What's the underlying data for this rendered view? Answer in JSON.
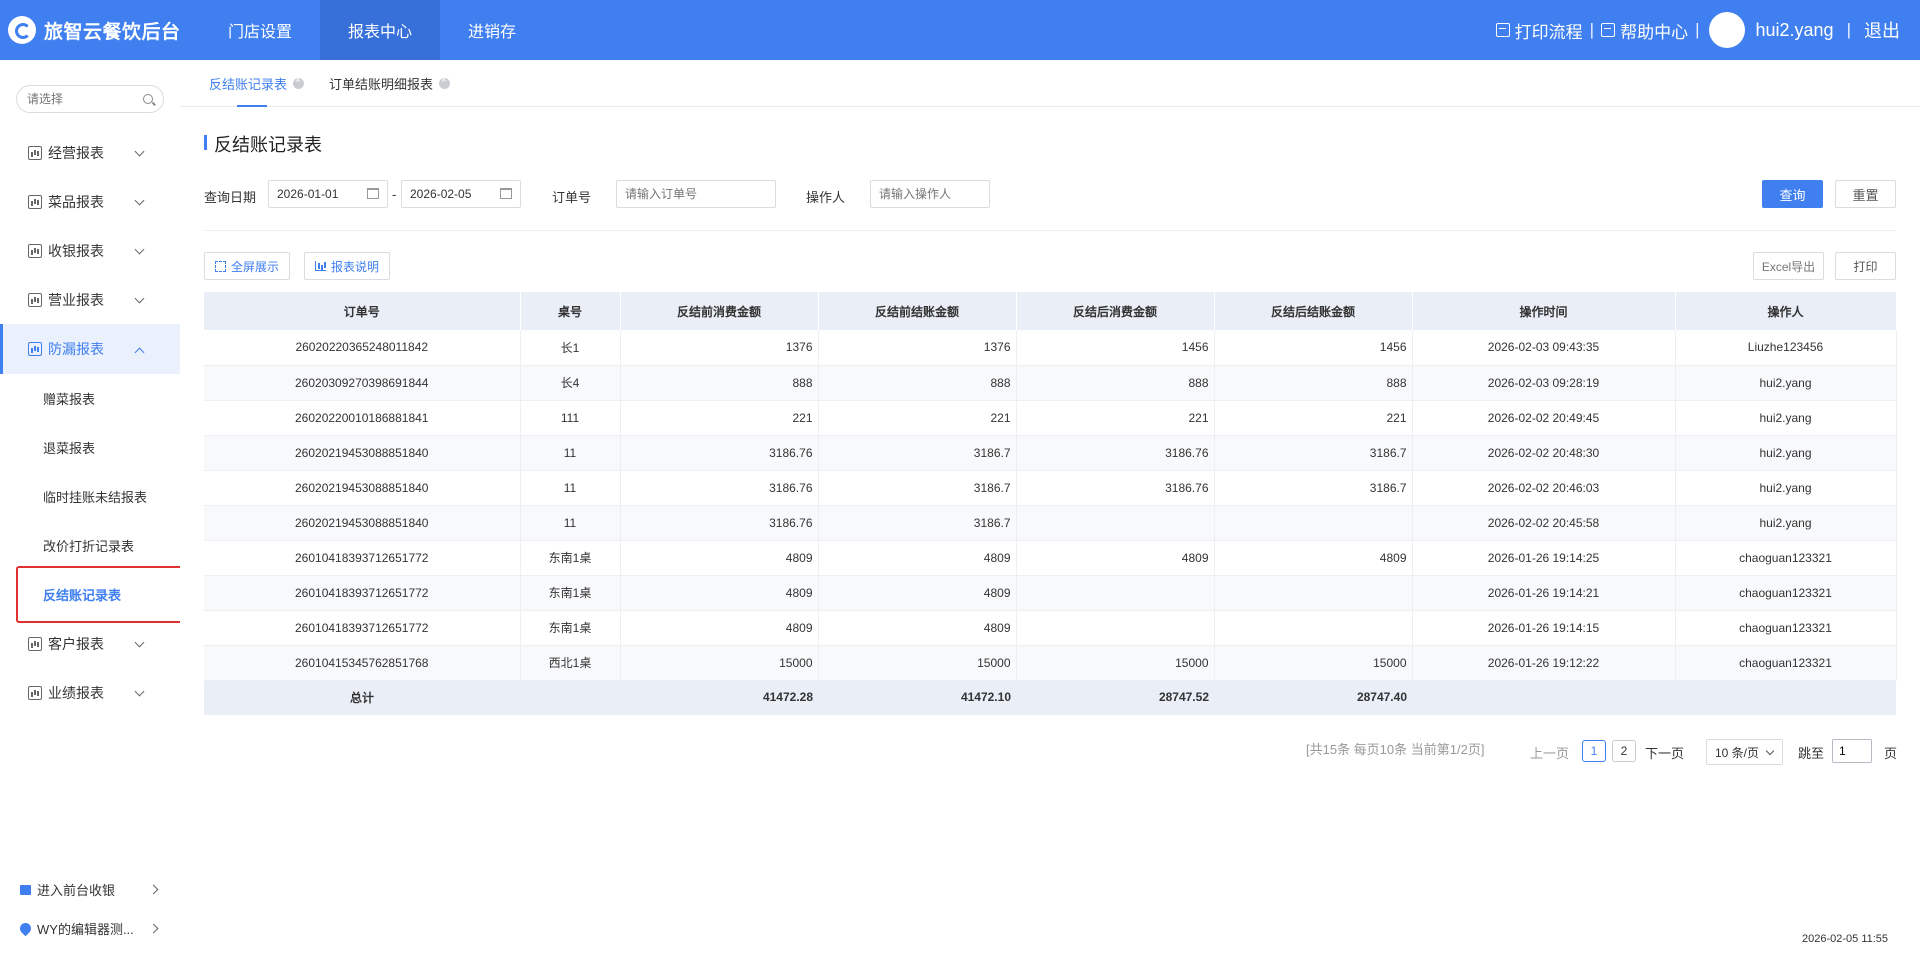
{
  "app": {
    "title": "旅智云餐饮后台"
  },
  "nav": {
    "items": [
      "门店设置",
      "报表中心",
      "进销存"
    ],
    "active_index": 1
  },
  "top_right": {
    "print_flow": "打印流程",
    "help_center": "帮助中心",
    "separator": "|",
    "username": "hui2.yang",
    "logout": "退出"
  },
  "sidebar": {
    "search_placeholder": "请选择",
    "menu": [
      {
        "label": "经营报表",
        "icon": "chart-icon"
      },
      {
        "label": "菜品报表",
        "icon": "dish-icon"
      },
      {
        "label": "收银报表",
        "icon": "cashier-icon"
      },
      {
        "label": "营业报表",
        "icon": "business-icon"
      },
      {
        "label": "防漏报表",
        "icon": "shield-icon"
      }
    ],
    "submenu": [
      "赠菜报表",
      "退菜报表",
      "临时挂账未结报表",
      "改价打折记录表",
      "反结账记录表"
    ],
    "menu_after": [
      {
        "label": "客户报表",
        "icon": "customer-icon"
      },
      {
        "label": "业绩报表",
        "icon": "performance-icon"
      }
    ],
    "bottom": {
      "front_cashier": "进入前台收银",
      "store": "WY的编辑器测..."
    }
  },
  "tabs": [
    {
      "label": "反结账记录表",
      "active": true
    },
    {
      "label": "订单结账明细报表",
      "active": false
    }
  ],
  "page": {
    "title": "反结账记录表"
  },
  "filters": {
    "date_label": "查询日期",
    "date_start": "2026-01-01",
    "date_sep": "-",
    "date_end": "2026-02-05",
    "order_label": "订单号",
    "order_placeholder": "请输入订单号",
    "operator_label": "操作人",
    "operator_placeholder": "请输入操作人",
    "query_button": "查询",
    "reset_button": "重置"
  },
  "toolbar": {
    "fullscreen": "全屏展示",
    "report_desc": "报表说明",
    "excel_export": "Excel导出",
    "print": "打印"
  },
  "table": {
    "columns": [
      "订单号",
      "桌号",
      "反结前消费金额",
      "反结前结账金额",
      "反结后消费金额",
      "反结后结账金额",
      "操作时间",
      "操作人"
    ],
    "rows": [
      [
        "2602022036524801184​2",
        "长1",
        "1376",
        "1376",
        "1456",
        "1456",
        "2026-02-03 09:43:35",
        "Liuzhe123456"
      ],
      [
        "2602030927039869184​4",
        "长4",
        "888",
        "888",
        "888",
        "888",
        "2026-02-03 09:28:19",
        "hui2.yang"
      ],
      [
        "2602022001018688184​1",
        "111",
        "221",
        "221",
        "221",
        "221",
        "2026-02-02 20:49:45",
        "hui2.yang"
      ],
      [
        "2602021945308885184​0",
        "11",
        "3186.76",
        "3186.7",
        "3186.76",
        "3186.7",
        "2026-02-02 20:48:30",
        "hui2.yang"
      ],
      [
        "2602021945308885184​0",
        "11",
        "3186.76",
        "3186.7",
        "3186.76",
        "3186.7",
        "2026-02-02 20:46:03",
        "hui2.yang"
      ],
      [
        "2602021945308885184​0",
        "11",
        "3186.76",
        "3186.7",
        "",
        "",
        "2026-02-02 20:45:58",
        "hui2.yang"
      ],
      [
        "2601041839371265177​2",
        "东南1桌",
        "4809",
        "4809",
        "4809",
        "4809",
        "2026-01-26 19:14:25",
        "chaoguan123321"
      ],
      [
        "2601041839371265177​2",
        "东南1桌",
        "4809",
        "4809",
        "",
        "",
        "2026-01-26 19:14:21",
        "chaoguan123321"
      ],
      [
        "2601041839371265177​2",
        "东南1桌",
        "4809",
        "4809",
        "",
        "",
        "2026-01-26 19:14:15",
        "chaoguan123321"
      ],
      [
        "2601041534576285176​8",
        "西北1桌",
        "15000",
        "15000",
        "15000",
        "15000",
        "2026-01-26 19:12:22",
        "chaoguan123321"
      ]
    ],
    "total": {
      "label": "总计",
      "before_consume": "41472.28",
      "before_settle": "41472.10",
      "after_consume": "28747.52",
      "after_settle": "28747.40"
    }
  },
  "pagination": {
    "summary": "[共15条 每页10条 当前第1/2页]",
    "prev": "上一页",
    "pages": [
      "1",
      "2"
    ],
    "current_page": 1,
    "next": "下一页",
    "page_size": "10 条/页",
    "jump_label": "跳至",
    "jump_value": "1",
    "page_unit": "页"
  },
  "footer": {
    "timestamp": "2026-02-05 11:55"
  },
  "colors": {
    "primary": "#3f7ff0",
    "highlight_border": "#e03030"
  }
}
